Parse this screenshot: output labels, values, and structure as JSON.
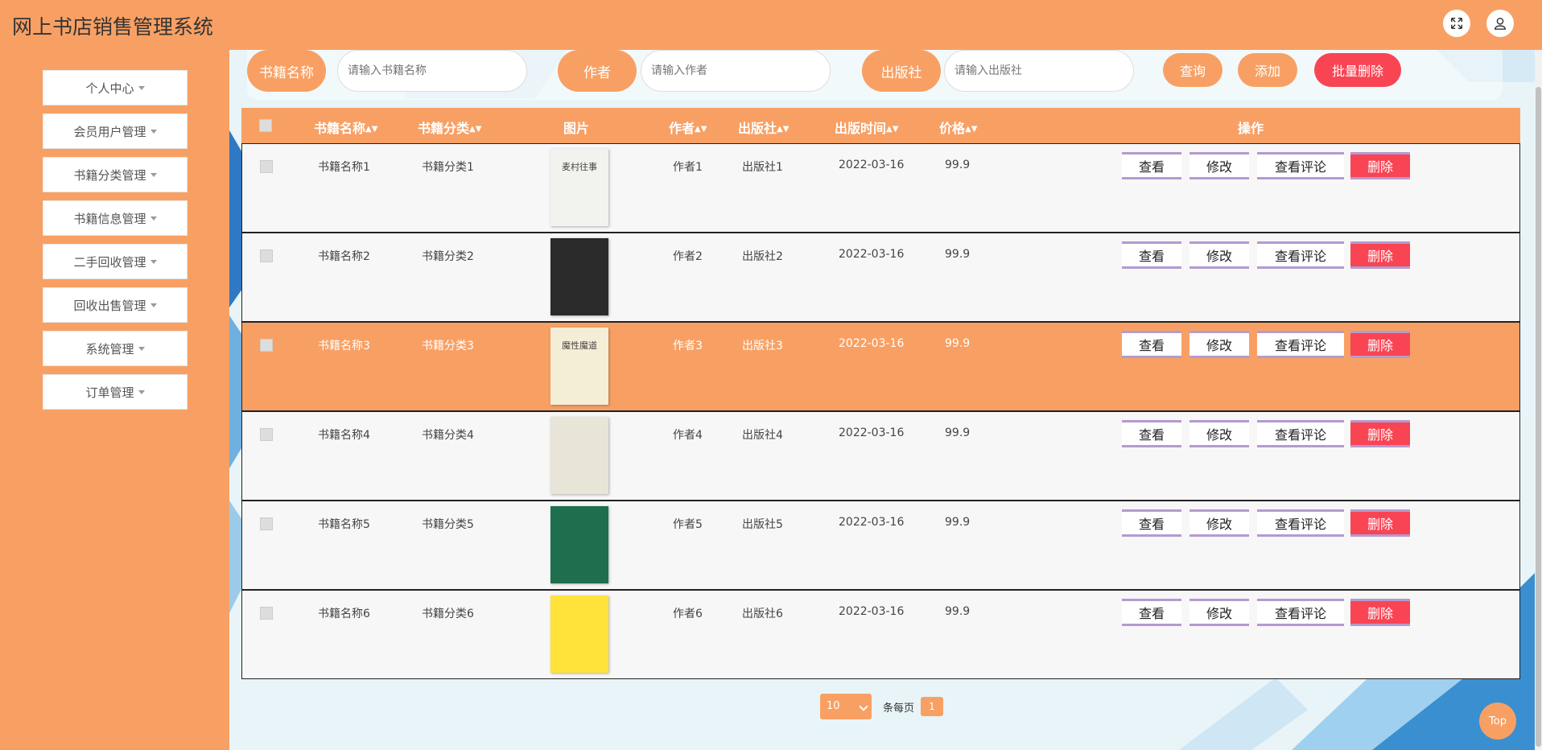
{
  "app": {
    "title": "网上书店销售管理系统"
  },
  "colors": {
    "accent": "#f8a064",
    "danger": "#f94453",
    "buttonBorder": "#b59ad0"
  },
  "header": {
    "fullscreen_icon": "expand-icon",
    "user_icon": "user-icon"
  },
  "sidebar": {
    "items": [
      {
        "label": "个人中心"
      },
      {
        "label": "会员用户管理"
      },
      {
        "label": "书籍分类管理"
      },
      {
        "label": "书籍信息管理"
      },
      {
        "label": "二手回收管理"
      },
      {
        "label": "回收出售管理"
      },
      {
        "label": "系统管理"
      },
      {
        "label": "订单管理"
      }
    ]
  },
  "search": {
    "name_label": "书籍名称",
    "name_placeholder": "请输入书籍名称",
    "author_label": "作者",
    "author_placeholder": "请输入作者",
    "publisher_label": "出版社",
    "publisher_placeholder": "请输入出版社",
    "query_button": "查询",
    "add_button": "添加",
    "batch_delete_button": "批量删除"
  },
  "table": {
    "headers": {
      "name": "书籍名称",
      "category": "书籍分类",
      "image": "图片",
      "author": "作者",
      "publisher": "出版社",
      "date": "出版时间",
      "price": "价格",
      "actions": "操作"
    },
    "action_labels": {
      "view": "查看",
      "edit": "修改",
      "comments": "查看评论",
      "delete": "删除"
    },
    "rows": [
      {
        "name": "书籍名称1",
        "category": "书籍分类1",
        "author": "作者1",
        "publisher": "出版社1",
        "date": "2022-03-16",
        "price": "99.9",
        "cover_color": "#f2f2ee",
        "cover_text": "麦村往事"
      },
      {
        "name": "书籍名称2",
        "category": "书籍分类2",
        "author": "作者2",
        "publisher": "出版社2",
        "date": "2022-03-16",
        "price": "99.9",
        "cover_color": "#2a2a2a",
        "cover_text": ""
      },
      {
        "name": "书籍名称3",
        "category": "书籍分类3",
        "author": "作者3",
        "publisher": "出版社3",
        "date": "2022-03-16",
        "price": "99.9",
        "cover_color": "#f5eed6",
        "cover_text": "魔性魔道"
      },
      {
        "name": "书籍名称4",
        "category": "书籍分类4",
        "author": "作者4",
        "publisher": "出版社4",
        "date": "2022-03-16",
        "price": "99.9",
        "cover_color": "#e9e4d8",
        "cover_text": ""
      },
      {
        "name": "书籍名称5",
        "category": "书籍分类5",
        "author": "作者5",
        "publisher": "出版社5",
        "date": "2022-03-16",
        "price": "99.9",
        "cover_color": "#1f6e4e",
        "cover_text": ""
      },
      {
        "name": "书籍名称6",
        "category": "书籍分类6",
        "author": "作者6",
        "publisher": "出版社6",
        "date": "2022-03-16",
        "price": "99.9",
        "cover_color": "#ffe23a",
        "cover_text": ""
      }
    ],
    "highlighted_row": 2
  },
  "pagination": {
    "page_size": "10",
    "per_page_label": "条每页",
    "current_page": "1"
  },
  "top_button": "Top"
}
